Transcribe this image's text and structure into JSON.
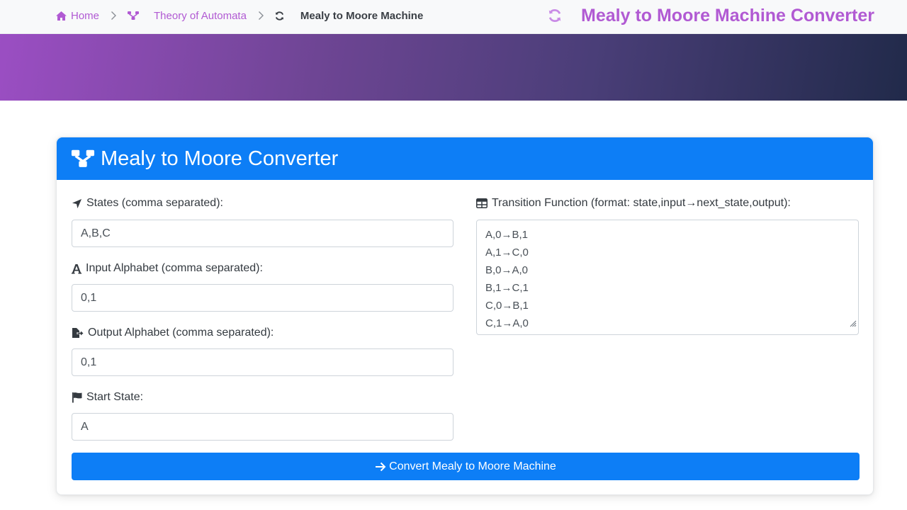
{
  "breadcrumb": {
    "home": "Home",
    "section": "Theory of Automata",
    "current": "Mealy to Moore Machine"
  },
  "header": {
    "title": "Mealy to Moore Machine Converter"
  },
  "card": {
    "title": "Mealy to Moore Converter"
  },
  "form": {
    "states_label": "States (comma separated):",
    "states_value": "A,B,C",
    "input_alphabet_label": "Input Alphabet (comma separated):",
    "input_alphabet_value": "0,1",
    "output_alphabet_label": "Output Alphabet (comma separated):",
    "output_alphabet_value": "0,1",
    "start_state_label": "Start State:",
    "start_state_value": "A",
    "transition_label": "Transition Function (format: state,input→next_state,output):",
    "transitions": [
      "A,0→B,1",
      "A,1→C,0",
      "B,0→A,0",
      "B,1→C,1",
      "C,0→B,1",
      "C,1→A,0"
    ],
    "convert_button": "Convert Mealy to Moore Machine"
  },
  "icons": {
    "home": "home-icon",
    "sitemap": "sitemap-icon",
    "refresh": "refresh-icon",
    "chevron": "chevron-right-icon",
    "location_arrow": "location-arrow-icon",
    "font": "font-icon",
    "file_export": "file-export-icon",
    "flag": "flag-icon",
    "table": "table-icon",
    "arrow_right": "arrow-right-icon"
  },
  "colors": {
    "accent_purple": "#b15ad3",
    "primary_blue": "#0d7ef6",
    "banner_start": "#9b4ec3",
    "banner_end": "#212a4a"
  }
}
